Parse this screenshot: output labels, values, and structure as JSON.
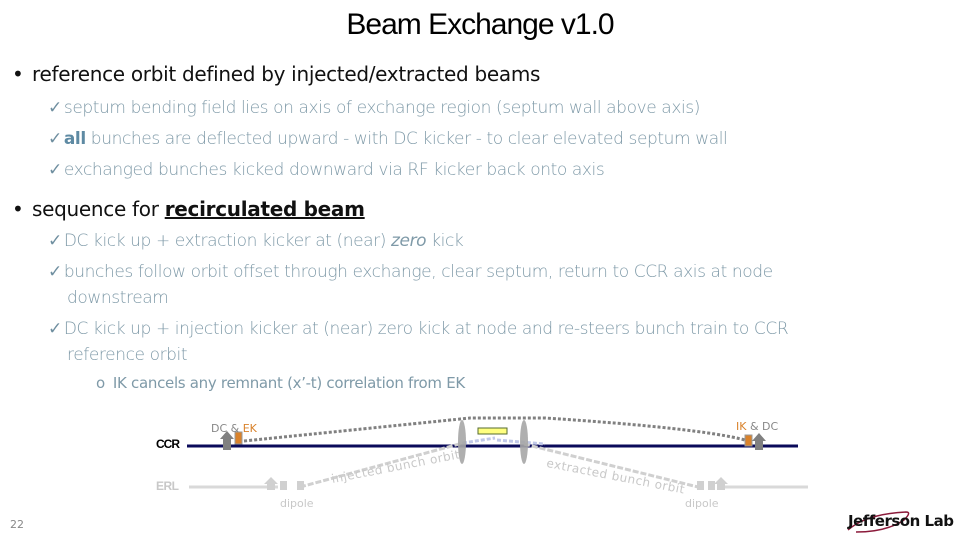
{
  "slide": {
    "title": "Beam Exchange v1.0",
    "page_number": "22",
    "logo_text": "Jefferson Lab"
  },
  "bullets": [
    {
      "text": "reference orbit defined by injected/extracted beams",
      "subitems": [
        {
          "text": "septum bending field lies on axis of exchange region (septum wall above axis)"
        },
        {
          "emph": "all",
          "text": " bunches are deflected upward - with DC kicker - to clear elevated septum wall"
        },
        {
          "text": "exchanged bunches kicked downward via RF kicker back onto axis"
        }
      ]
    },
    {
      "text_prefix": "sequence for ",
      "text_emph": "recirculated beam",
      "subitems": [
        {
          "text_prefix": "DC kick up + extraction kicker at (near) ",
          "text_ital": "zero",
          "text_suffix": " kick"
        },
        {
          "line1": "bunches follow orbit offset through exchange, clear septum, return to CCR axis at node",
          "line2": "downstream"
        },
        {
          "line1": "DC kick up + injection kicker at (near) zero kick at node and re-steers bunch train to CCR",
          "line2": "reference orbit",
          "subitems": [
            {
              "text": "IK cancels any remnant (x’-t) correlation from EK"
            }
          ]
        }
      ]
    }
  ],
  "icons": {
    "bullet": "•",
    "check": "✓",
    "sub_bullet": "o"
  },
  "diagram": {
    "ccr_label": "CCR",
    "erl_label": "ERL",
    "left_kicker_label_dc": "DC & ",
    "left_kicker_label_ek": "EK",
    "right_kicker_label_ik": "IK",
    "right_kicker_label_dc": " & DC",
    "dipole_left": "dipole",
    "dipole_right": "dipole",
    "injected_orbit_label": "injected bunch orbit",
    "extracted_orbit_label": "extracted bunch orbit",
    "colors": {
      "ccr_line": "#0a0a5a",
      "erl_line": "#d9d9d9",
      "kicker_dc": "#808080",
      "kicker_rf": "#d9822b",
      "septum": "#a6a6a6",
      "septum_center": "#ffff80",
      "orbit_dashed": "#808080"
    }
  }
}
